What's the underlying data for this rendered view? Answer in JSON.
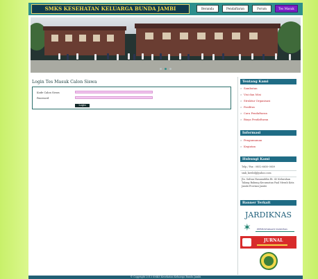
{
  "header": {
    "brand": "SMKS KESEHATAN KELUARGA BUNDA JAMBI",
    "nav": [
      {
        "label": "Beranda",
        "active": false
      },
      {
        "label": "Pendaftaran",
        "active": false
      },
      {
        "label": "Forum",
        "active": false
      },
      {
        "label": "Tes Masuk",
        "active": true
      }
    ]
  },
  "slider": {
    "dots": 3,
    "active_dot": 1
  },
  "login": {
    "title": "Login Tes Masuk Calon Siswa",
    "kode_label": "Kode Calon Siswa",
    "password_label": "Password",
    "button_label": "Login"
  },
  "sidebar": {
    "tentang": {
      "title": "Tentang Kami",
      "items": [
        "Sambutan",
        "Visi dan Misi",
        "Struktur Organisasi",
        "Fasilitas",
        "Cara Pendaftaran",
        "Biaya Pendaftaran"
      ]
    },
    "informasi": {
      "title": "Informasi",
      "items": [
        "Pengumuman",
        "Kegiatan"
      ]
    },
    "hubungi": {
      "title": "Hubungi Kami",
      "phone": "Telp / Fax : 0852-6650-0859",
      "email": "smk_kwsbdj@yahoo.com",
      "address": "Jln. Sultan Hasanuddin Rt. 43 Kelurahan Talang Bakung Kecamatan Paal Merah Kota Jambi Provinsi Jambi"
    },
    "banner": {
      "title": "Banner Terkait",
      "jardiknas": "JARDIKNAS",
      "perpustakaan": "PERPUSTAKAAN NASIONAL",
      "jurnal": "JURNAL"
    }
  },
  "footer": {
    "text": "© Copyright 2013 SMKS Kesehatan Keluarga Bunda Jambi"
  },
  "colors": {
    "accent": "#7b1fc7",
    "header": "#2d8f8c",
    "sidebar_heading": "#1f6c85",
    "link": "#c3252a"
  }
}
